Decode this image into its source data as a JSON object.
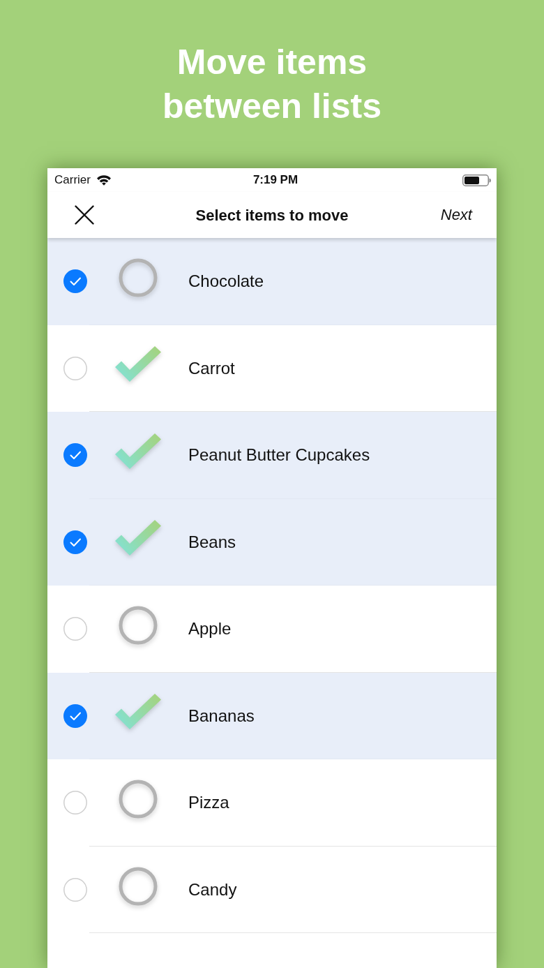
{
  "headline": "Move items between lists",
  "status_bar": {
    "carrier": "Carrier",
    "time": "7:19 PM"
  },
  "nav_bar": {
    "title": "Select items to move",
    "right_button": "Next"
  },
  "items": [
    {
      "name": "Chocolate",
      "selected": true,
      "completed": false
    },
    {
      "name": "Carrot",
      "selected": false,
      "completed": true
    },
    {
      "name": "Peanut Butter Cupcakes",
      "selected": true,
      "completed": true
    },
    {
      "name": "Beans",
      "selected": true,
      "completed": true
    },
    {
      "name": "Apple",
      "selected": false,
      "completed": false
    },
    {
      "name": "Bananas",
      "selected": true,
      "completed": true
    },
    {
      "name": "Pizza",
      "selected": false,
      "completed": false
    },
    {
      "name": "Candy",
      "selected": false,
      "completed": false
    }
  ]
}
